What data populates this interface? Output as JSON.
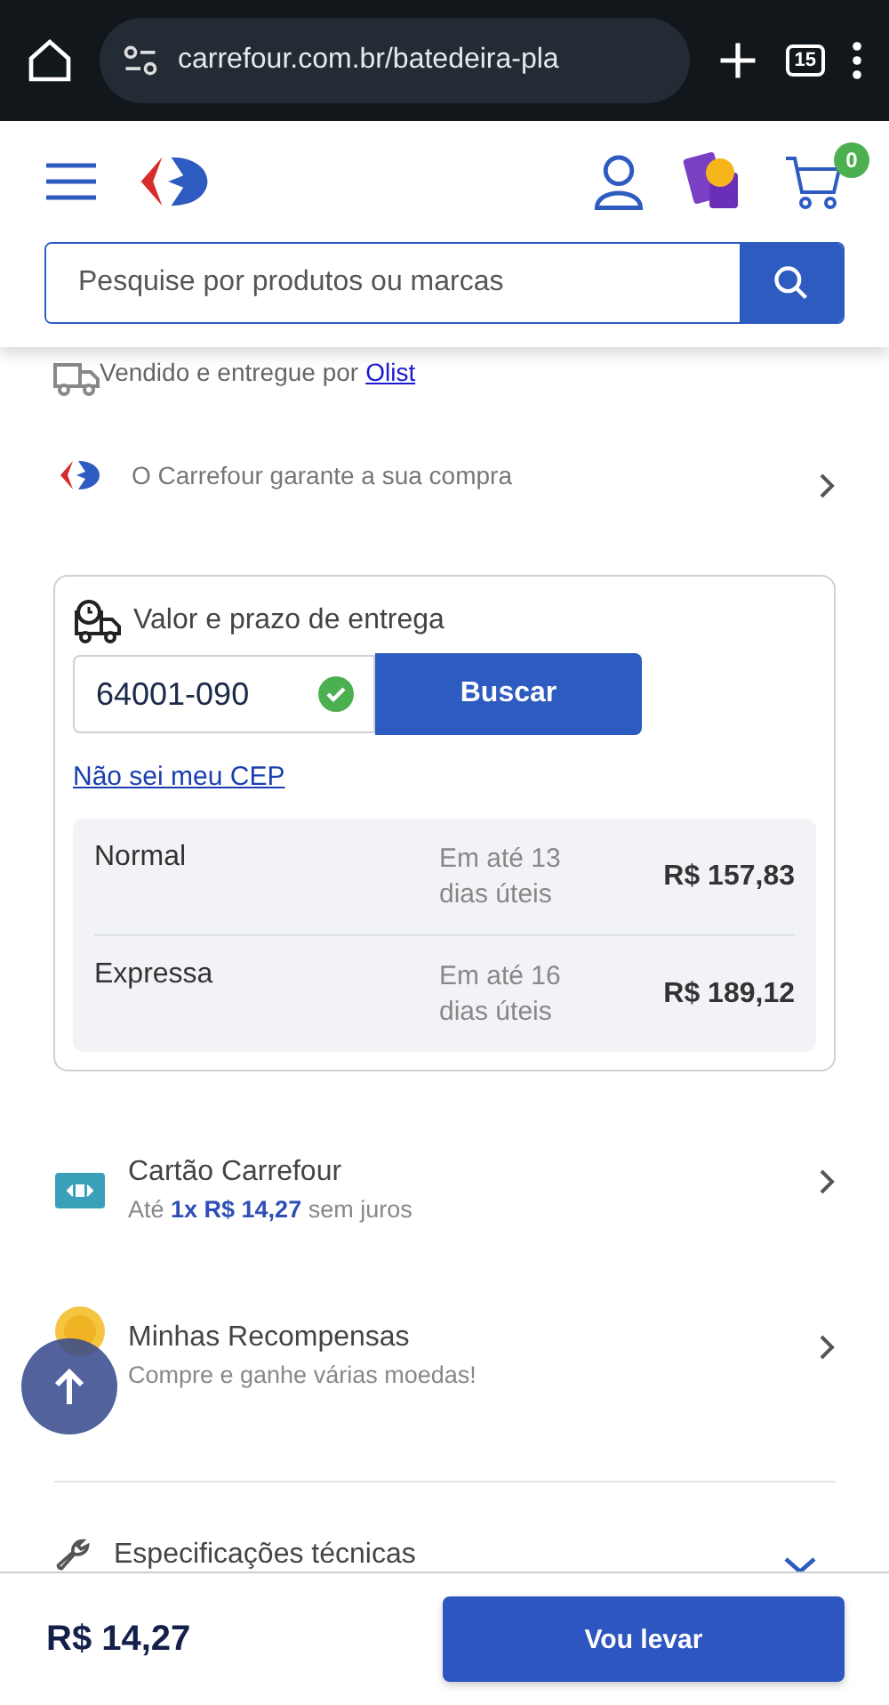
{
  "browser": {
    "url": "carrefour.com.br/batedeira-pla",
    "tab_count": "15"
  },
  "header": {
    "search": {
      "placeholder": "Pesquise por produtos ou marcas"
    },
    "cart_count": "0"
  },
  "seller": {
    "text": "Vendido e entregue por",
    "link": "Olist"
  },
  "guarantee": {
    "text": "O Carrefour garante a sua compra"
  },
  "delivery": {
    "title": "Valor e prazo de entrega",
    "cep": {
      "value": "64001-090",
      "valid": true
    },
    "button": "Buscar",
    "help_link": "Não sei meu CEP",
    "options": [
      {
        "name": "Normal",
        "time": "Em até 13 dias úteis",
        "price": "R$ 157,83"
      },
      {
        "name": "Expressa",
        "time": "Em até 16 dias úteis",
        "price": "R$ 189,12"
      }
    ]
  },
  "benefits": [
    {
      "kind": "card",
      "title": "Cartão Carrefour",
      "subtitle": "Até **1x R$ 14,27** sem juros"
    },
    {
      "kind": "coins",
      "title": "Minhas Recompensas",
      "subtitle": "Compre e ganhe várias moedas!"
    }
  ],
  "specs": {
    "title": "Especificações técnicas",
    "expanded": false
  },
  "footer": {
    "price": "R$ 14,27",
    "button": "Vou levar"
  }
}
